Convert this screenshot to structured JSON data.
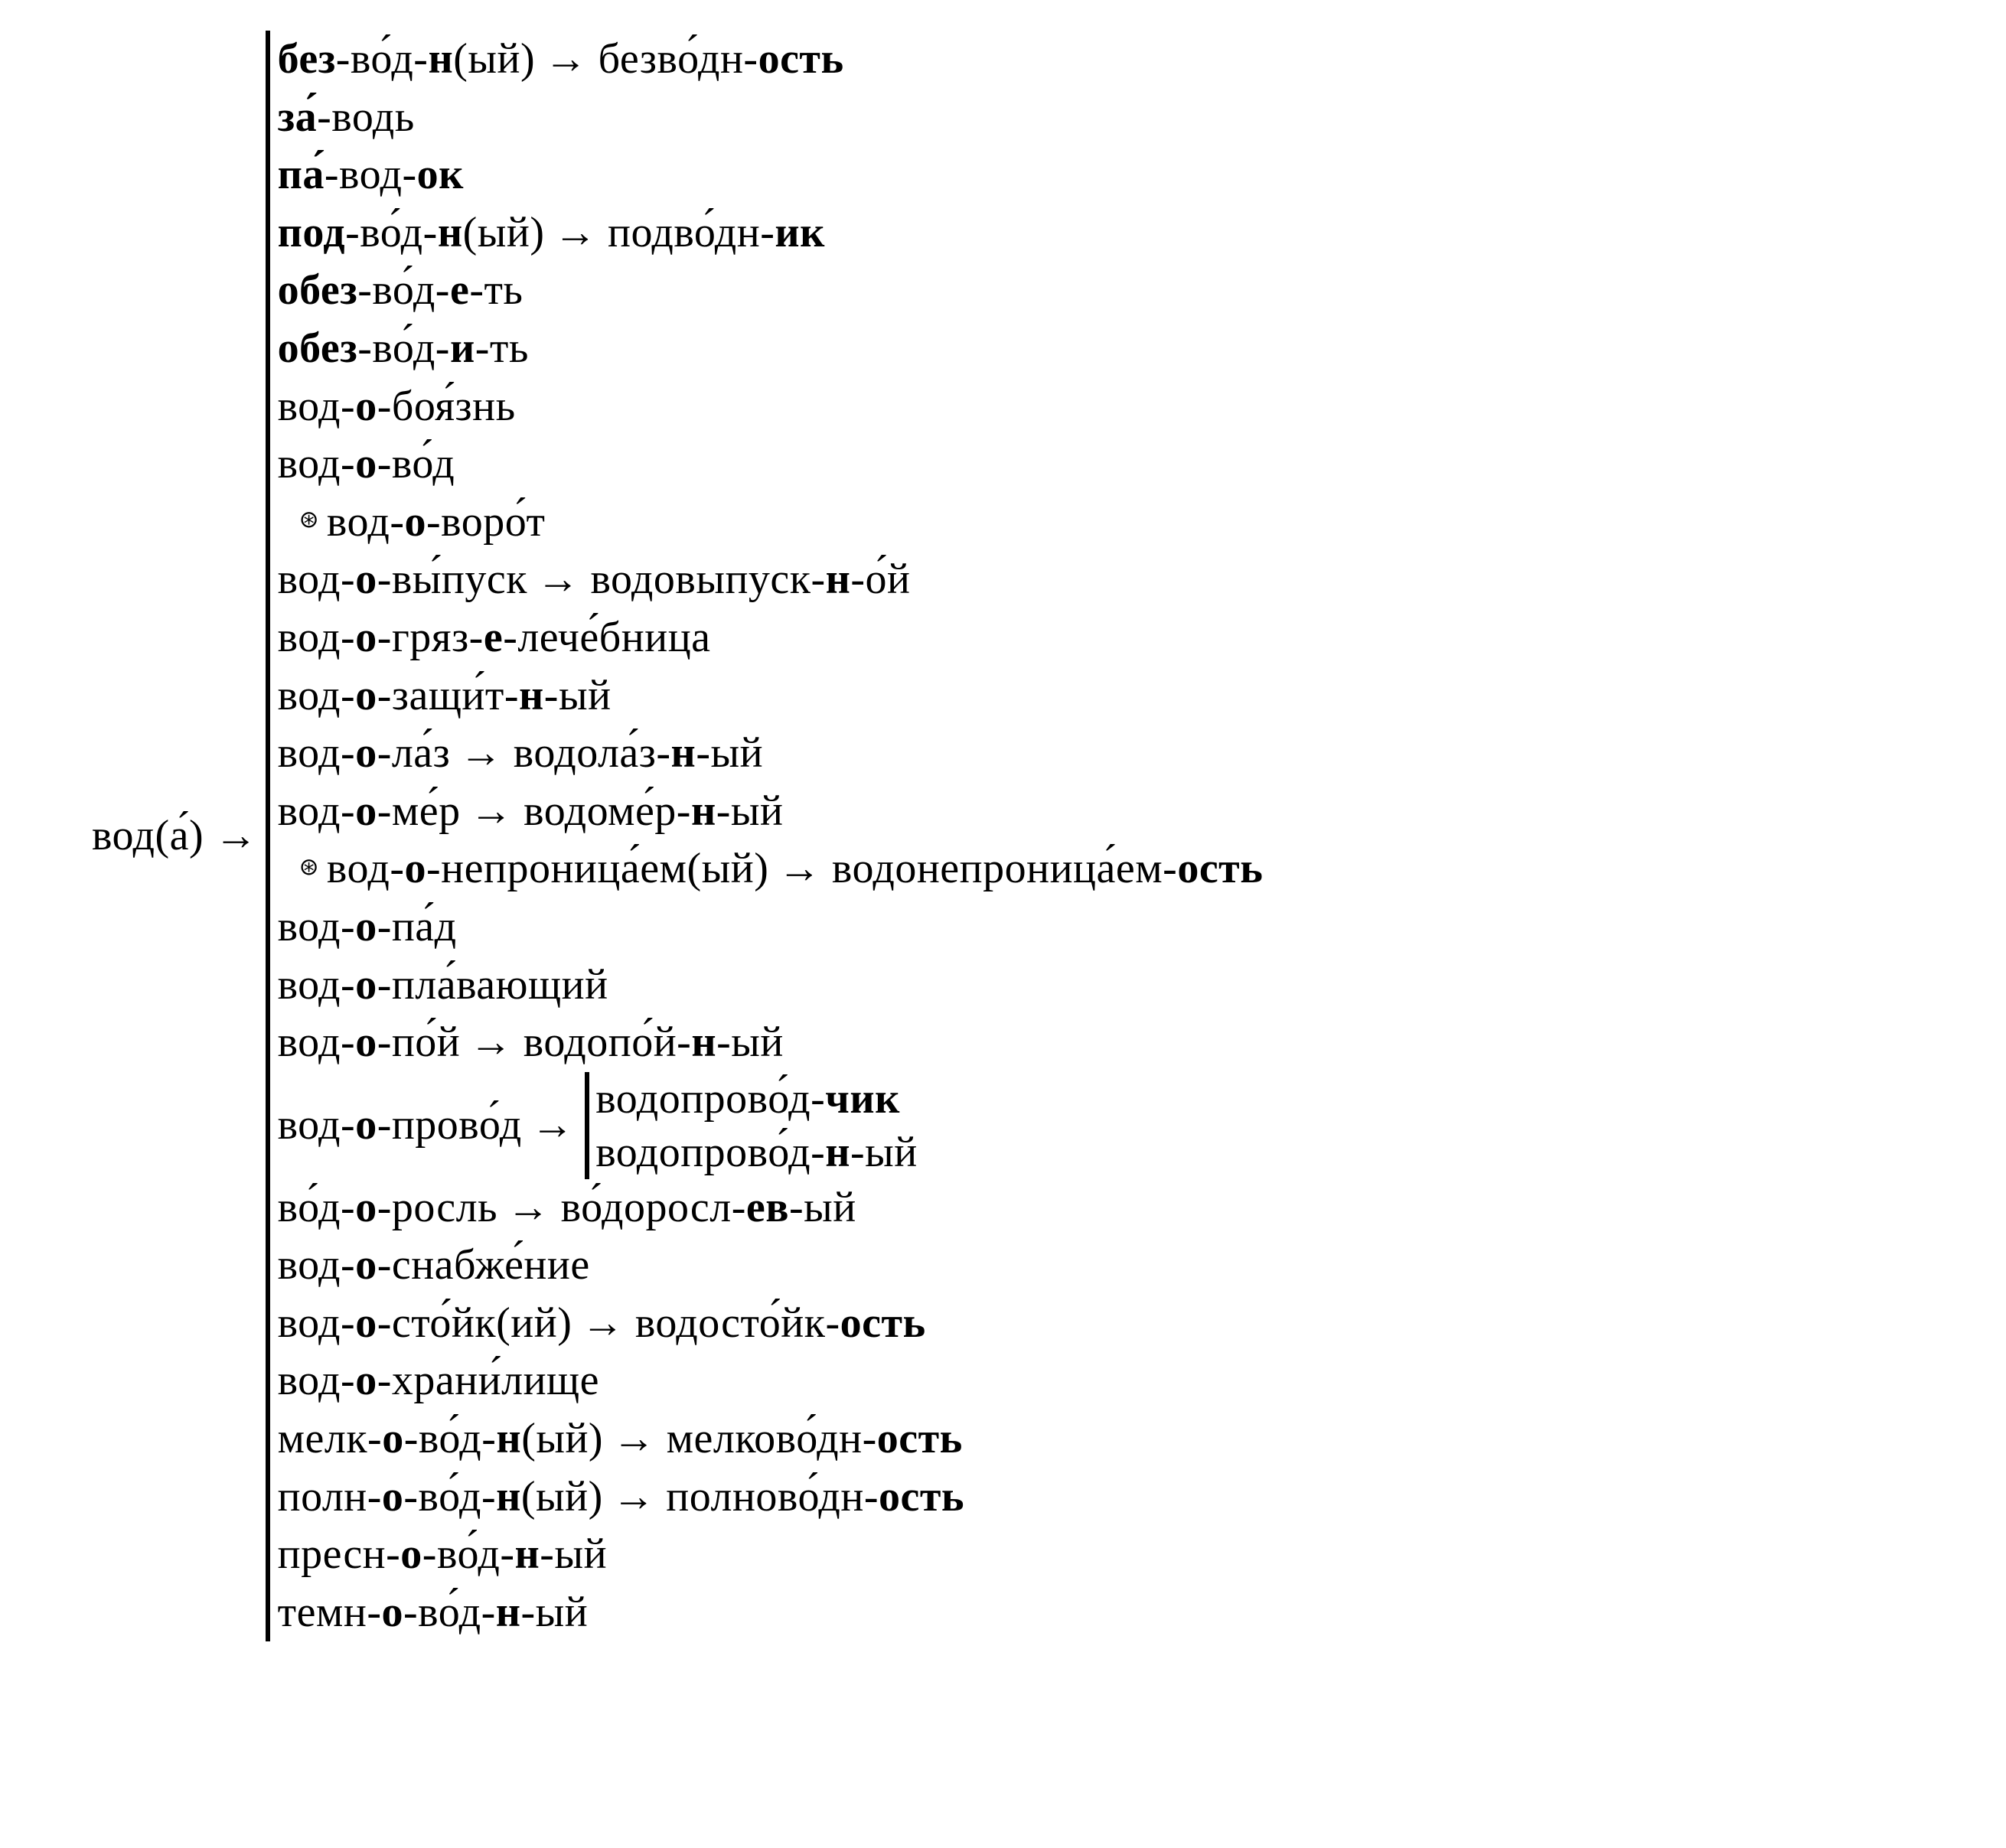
{
  "root_html": "вод(а́)",
  "arrow": "→",
  "bullet": "⊛",
  "entries": [
    {
      "type": "line",
      "parts": [
        {
          "html": "<b>без</b>-во́д-<b>н</b>(ый)"
        },
        {
          "arrow": true
        },
        {
          "html": "безво́дн-<b>ость</b>"
        }
      ]
    },
    {
      "type": "line",
      "parts": [
        {
          "html": "<b>за́</b>-водь"
        }
      ]
    },
    {
      "type": "line",
      "parts": [
        {
          "html": "<b>па́</b>-вод-<b>ок</b>"
        }
      ]
    },
    {
      "type": "line",
      "parts": [
        {
          "html": "<b>под</b>-во́д-<b>н</b>(ый)"
        },
        {
          "arrow": true
        },
        {
          "html": "подво́дн-<b>ик</b>"
        }
      ]
    },
    {
      "type": "line",
      "parts": [
        {
          "html": "<b>обез</b>-во́д-<b>е</b>-ть"
        }
      ]
    },
    {
      "type": "line",
      "parts": [
        {
          "html": "<b>обез</b>-во́д-<b>и</b>-ть"
        }
      ]
    },
    {
      "type": "line",
      "parts": [
        {
          "html": "вод-<b>о</b>-боя́знь"
        }
      ]
    },
    {
      "type": "line",
      "parts": [
        {
          "html": "вод-<b>о</b>-во́д"
        }
      ]
    },
    {
      "type": "line",
      "indent": 1,
      "bullet": true,
      "parts": [
        {
          "html": "вод-<b>о</b>-воро́т"
        }
      ]
    },
    {
      "type": "line",
      "parts": [
        {
          "html": "вод-<b>о</b>-вы́пуск"
        },
        {
          "arrow": true
        },
        {
          "html": "водовыпуск-<b>н</b>-о́й"
        }
      ]
    },
    {
      "type": "line",
      "parts": [
        {
          "html": "вод-<b>о</b>-гряз-<b>е</b>-лече́бница"
        }
      ]
    },
    {
      "type": "line",
      "parts": [
        {
          "html": "вод-<b>о</b>-защи́т-<b>н</b>-ый"
        }
      ]
    },
    {
      "type": "line",
      "parts": [
        {
          "html": "вод-<b>о</b>-ла́з"
        },
        {
          "arrow": true
        },
        {
          "html": "водола́з-<b>н</b>-ый"
        }
      ]
    },
    {
      "type": "line",
      "parts": [
        {
          "html": "вод-<b>о</b>-ме́р"
        },
        {
          "arrow": true
        },
        {
          "html": "водоме́р-<b>н</b>-ый"
        }
      ]
    },
    {
      "type": "line",
      "indent": 1,
      "bullet": true,
      "parts": [
        {
          "html": "вод-<b>о</b>-непроница́ем(ый)"
        },
        {
          "arrow": true
        },
        {
          "html": "водонепроница́ем-<b>ость</b>"
        }
      ]
    },
    {
      "type": "line",
      "parts": [
        {
          "html": "вод-<b>о</b>-па́д"
        }
      ]
    },
    {
      "type": "line",
      "parts": [
        {
          "html": "вод-<b>о</b>-пла́вающий"
        }
      ]
    },
    {
      "type": "line",
      "parts": [
        {
          "html": "вод-<b>о</b>-по́й"
        },
        {
          "arrow": true
        },
        {
          "html": "водопо́й-<b>н</b>-ый"
        }
      ]
    },
    {
      "type": "nested",
      "head_html": "вод-<b>о</b>-прово́д",
      "children": [
        {
          "html": "водопрово́д-<b>чик</b>"
        },
        {
          "html": "водопрово́д-<b>н</b>-ый"
        }
      ]
    },
    {
      "type": "line",
      "parts": [
        {
          "html": "во́д-<b>о</b>-росль"
        },
        {
          "arrow": true
        },
        {
          "html": "во́доросл-<b>ев</b>-ый"
        }
      ]
    },
    {
      "type": "line",
      "parts": [
        {
          "html": "вод-<b>о</b>-снабже́ние"
        }
      ]
    },
    {
      "type": "line",
      "parts": [
        {
          "html": "вод-<b>о</b>-сто́йк(ий)"
        },
        {
          "arrow": true
        },
        {
          "html": "водосто́йк-<b>ость</b>"
        }
      ]
    },
    {
      "type": "line",
      "parts": [
        {
          "html": "вод-<b>о</b>-храни́лище"
        }
      ]
    },
    {
      "type": "line",
      "parts": [
        {
          "html": "мелк-<b>о</b>-во́д-<b>н</b>(ый)"
        },
        {
          "arrow": true
        },
        {
          "html": "мелково́дн-<b>ость</b>"
        }
      ]
    },
    {
      "type": "line",
      "parts": [
        {
          "html": "полн-<b>о</b>-во́д-<b>н</b>(ый)"
        },
        {
          "arrow": true
        },
        {
          "html": "полново́дн-<b>ость</b>"
        }
      ]
    },
    {
      "type": "line",
      "parts": [
        {
          "html": "пресн-<b>о</b>-во́д-<b>н</b>-ый"
        }
      ]
    },
    {
      "type": "line",
      "parts": [
        {
          "html": "темн-<b>о</b>-во́д-<b>н</b>-ый"
        }
      ]
    }
  ]
}
